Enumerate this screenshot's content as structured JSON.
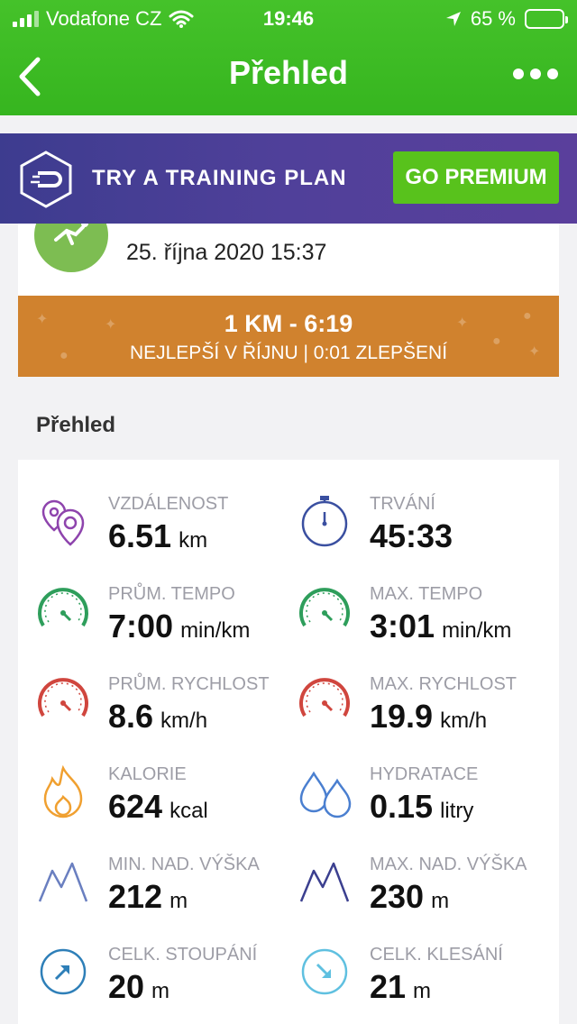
{
  "status_bar": {
    "carrier": "Vodafone CZ",
    "time": "19:46",
    "battery": "65 %"
  },
  "nav": {
    "title": "Přehled"
  },
  "banner": {
    "text": "TRY A TRAINING PLAN",
    "button": "GO PREMIUM"
  },
  "activity": {
    "date": "25. října 2020 15:37",
    "record_main": "1 KM - 6:19",
    "record_sub": "NEJLEPŠÍ V ŘÍJNU  |  0:01 ZLEPŠENÍ"
  },
  "section": {
    "title": "Přehled"
  },
  "stats": [
    {
      "label": "VZDÁLENOST",
      "value": "6.51",
      "unit": "km",
      "icon": "location-pins-icon",
      "color": "#8e44ad"
    },
    {
      "label": "TRVÁNÍ",
      "value": "45:33",
      "unit": "",
      "icon": "stopwatch-icon",
      "color": "#3a4fa0"
    },
    {
      "label": "PRŮM. TEMPO",
      "value": "7:00",
      "unit": "min/km",
      "icon": "gauge-icon",
      "color": "#2e9e5b"
    },
    {
      "label": "MAX. TEMPO",
      "value": "3:01",
      "unit": "min/km",
      "icon": "gauge-icon",
      "color": "#2e9e5b"
    },
    {
      "label": "PRŮM. RYCHLOST",
      "value": "8.6",
      "unit": "km/h",
      "icon": "gauge-icon",
      "color": "#d0463e"
    },
    {
      "label": "MAX. RYCHLOST",
      "value": "19.9",
      "unit": "km/h",
      "icon": "gauge-icon",
      "color": "#d0463e"
    },
    {
      "label": "KALORIE",
      "value": "624",
      "unit": "kcal",
      "icon": "flame-icon",
      "color": "#f0a030"
    },
    {
      "label": "HYDRATACE",
      "value": "0.15",
      "unit": "litry",
      "icon": "water-drops-icon",
      "color": "#4a7fd0"
    },
    {
      "label": "MIN. NAD. VÝŠKA",
      "value": "212",
      "unit": "m",
      "icon": "mountains-icon",
      "color": "#6a7fc0"
    },
    {
      "label": "MAX. NAD. VÝŠKA",
      "value": "230",
      "unit": "m",
      "icon": "mountains-icon",
      "color": "#3b3f8f"
    },
    {
      "label": "CELK. STOUPÁNÍ",
      "value": "20",
      "unit": "m",
      "icon": "arrow-up-circle-icon",
      "color": "#2e7fb8"
    },
    {
      "label": "CELK. KLESÁNÍ",
      "value": "21",
      "unit": "m",
      "icon": "arrow-down-circle-icon",
      "color": "#5fc0e0"
    }
  ]
}
